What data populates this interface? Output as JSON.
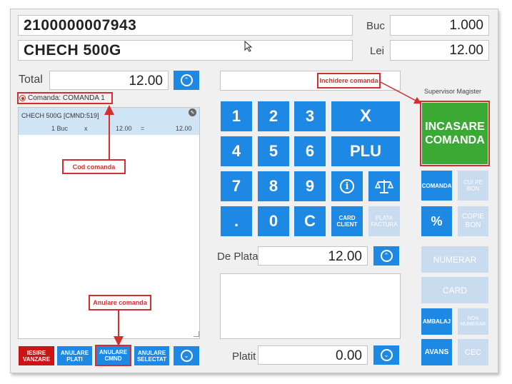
{
  "header": {
    "barcode": "2100000007943",
    "product_name": "CHECH 500G",
    "qty_label": "Buc",
    "qty_value": "1.000",
    "price_label": "Lei",
    "price_value": "12.00"
  },
  "left": {
    "total_label": "Total",
    "total_value": "12.00",
    "order_label": "Comanda: COMANDA 1",
    "item": {
      "name": "CHECH 500G [CMND:519]",
      "qty": "1 Buc",
      "x": "x",
      "price": "12.00",
      "eq": "=",
      "line_total": "12.00"
    },
    "buttons": {
      "iesire_line1": "IESIRE",
      "iesire_line2": "VANZARE",
      "anulare_plati_line1": "ANULARE",
      "anulare_plati_line2": "PLATI",
      "anulare_cmnd_line1": "ANULARE",
      "anulare_cmnd_line2": "CMND",
      "anulare_sel_line1": "ANULARE",
      "anulare_sel_line2": "SELECTAT"
    }
  },
  "keypad": {
    "k1": "1",
    "k2": "2",
    "k3": "3",
    "kx": "X",
    "k4": "4",
    "k5": "5",
    "k6": "6",
    "kplu": "PLU",
    "k7": "7",
    "k8": "8",
    "k9": "9",
    "kdot": ".",
    "k0": "0",
    "kc": "C",
    "card_client_line1": "CARD",
    "card_client_line2": "CLIENT",
    "plata_factura_line1": "PLATA",
    "plata_factura_line2": "FACTURA"
  },
  "payment": {
    "de_plata_label": "De Plata",
    "de_plata_value": "12.00",
    "platit_label": "Platit",
    "platit_value": "0.00"
  },
  "right": {
    "supervisor": "Supervisor Magister",
    "incasare_line1": "INCASARE",
    "incasare_line2": "COMANDA",
    "comanda": "COMANDA",
    "cui_line1": "CUI PE",
    "cui_line2": "BON",
    "percent": "%",
    "copie_line1": "COPIE",
    "copie_line2": "BON",
    "numerar": "NUMERAR",
    "card": "CARD",
    "ambalaj": "AMBALAJ",
    "non_num_line1": "NON",
    "non_num_line2": "NUMERAR",
    "avans": "AVANS",
    "cec": "CEC"
  },
  "annotations": {
    "inchidere": "Inchidere comanda",
    "cod": "Cod comanda",
    "anulare": "Anulare comanda"
  },
  "colors": {
    "accent": "#1e88e5",
    "disabled": "#c9dbee",
    "green": "#3aaa35",
    "annotation": "#d32f2f",
    "exit": "#cc1414"
  }
}
